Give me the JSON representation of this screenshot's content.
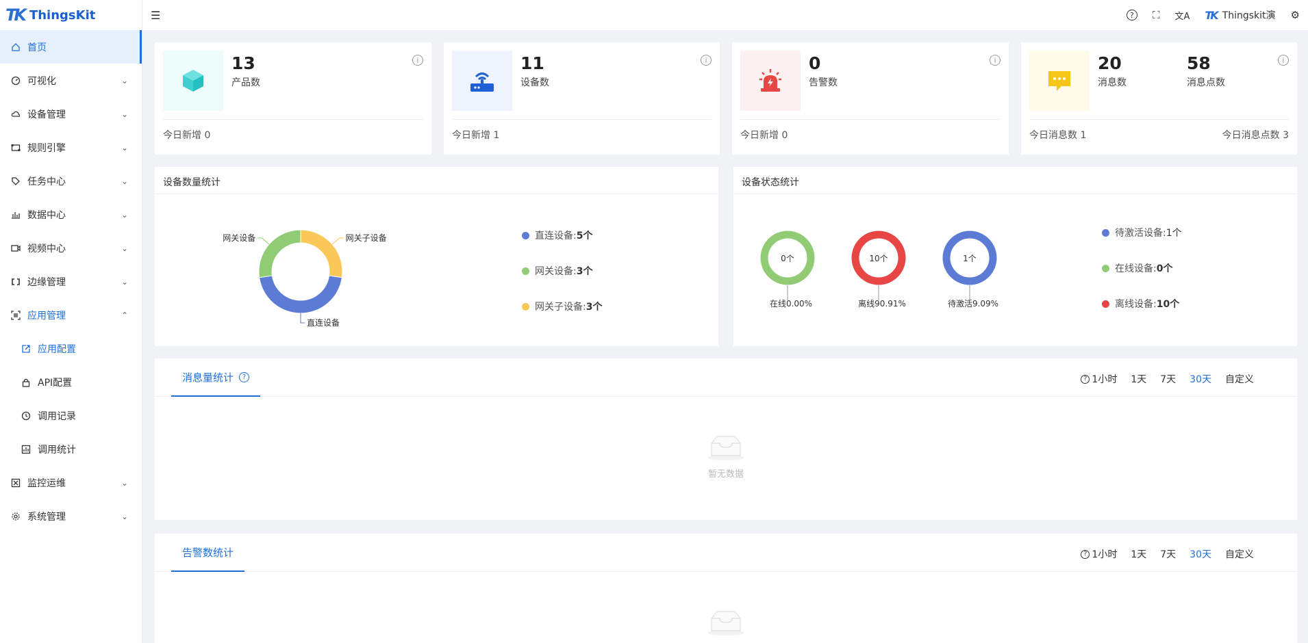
{
  "app": {
    "name": "ThingsKit",
    "logo_mark": "TK"
  },
  "topbar": {
    "username": "Thingskit演"
  },
  "sidebar": {
    "items": [
      {
        "label": "首页"
      },
      {
        "label": "可视化"
      },
      {
        "label": "设备管理"
      },
      {
        "label": "规则引擎"
      },
      {
        "label": "任务中心"
      },
      {
        "label": "数据中心"
      },
      {
        "label": "视频中心"
      },
      {
        "label": "边缘管理"
      },
      {
        "label": "应用管理"
      },
      {
        "label": "应用配置"
      },
      {
        "label": "API配置"
      },
      {
        "label": "调用记录"
      },
      {
        "label": "调用统计"
      },
      {
        "label": "监控运维"
      },
      {
        "label": "系统管理"
      }
    ]
  },
  "stats": {
    "products": {
      "value": "13",
      "label": "产品数",
      "foot": "今日新增 0"
    },
    "devices": {
      "value": "11",
      "label": "设备数",
      "foot": "今日新增 1"
    },
    "alarms": {
      "value": "0",
      "label": "告警数",
      "foot": "今日新增 0"
    },
    "messages": {
      "value": "20",
      "label": "消息数",
      "value2": "58",
      "label2": "消息点数",
      "foot": "今日消息数 1",
      "foot2": "今日消息点数 3"
    }
  },
  "device_count_panel": {
    "title": "设备数量统计",
    "legend": [
      {
        "name": "直连设备:",
        "value": "5个",
        "color": "#5b7bd5"
      },
      {
        "name": "网关设备:",
        "value": "3个",
        "color": "#91cc75"
      },
      {
        "name": "网关子设备:",
        "value": "3个",
        "color": "#fac858"
      }
    ]
  },
  "device_status_panel": {
    "title": "设备状态统计",
    "legend": [
      {
        "name": "待激活设备:",
        "value": "1个",
        "color": "#5b7bd5"
      },
      {
        "name": "在线设备:",
        "value": "0个",
        "color": "#91cc75"
      },
      {
        "name": "离线设备:",
        "value": "10个",
        "color": "#e84545"
      }
    ]
  },
  "message_panel": {
    "tab": "消息量统计",
    "ranges": [
      "1小时",
      "1天",
      "7天",
      "30天",
      "自定义"
    ],
    "empty_text": "暂无数据"
  },
  "alarm_panel": {
    "tab": "告警数统计",
    "ranges": [
      "1小时",
      "1天",
      "7天",
      "30天",
      "自定义"
    ]
  },
  "chart_data": [
    {
      "type": "pie",
      "title": "设备数量统计",
      "labels": [
        "直连设备",
        "网关设备",
        "网关子设备"
      ],
      "values": [
        5,
        3,
        3
      ],
      "colors": [
        "#5b7bd5",
        "#91cc75",
        "#fac858"
      ],
      "donut": true
    },
    {
      "type": "pie",
      "title": "设备状态统计",
      "gauges": [
        {
          "center_text": "0个",
          "label": "在线0.00%",
          "color": "#91cc75"
        },
        {
          "center_text": "10个",
          "label": "离线90.91%",
          "color": "#e84545"
        },
        {
          "center_text": "1个",
          "label": "待激活9.09%",
          "color": "#5b7bd5"
        }
      ]
    }
  ]
}
